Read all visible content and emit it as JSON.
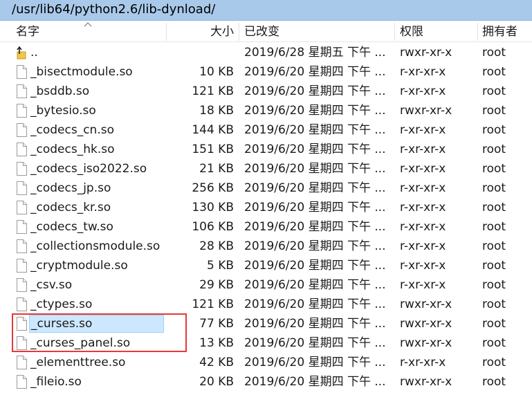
{
  "path": "/usr/lib64/python2.6/lib-dynload/",
  "columns": {
    "name": "名字",
    "size": "大小",
    "modified": "已改变",
    "permissions": "权限",
    "owner": "拥有者"
  },
  "rows": [
    {
      "name": "..",
      "size": "",
      "modified": "2019/6/28 星期五 下午 ...",
      "perm": "rwxr-xr-x",
      "owner": "root",
      "icon": "parent-folder-icon"
    },
    {
      "name": "_bisectmodule.so",
      "size": "10 KB",
      "modified": "2019/6/20 星期四 下午 ...",
      "perm": "r-xr-xr-x",
      "owner": "root",
      "icon": "file-icon"
    },
    {
      "name": "_bsddb.so",
      "size": "121 KB",
      "modified": "2019/6/20 星期四 下午 ...",
      "perm": "r-xr-xr-x",
      "owner": "root",
      "icon": "file-icon"
    },
    {
      "name": "_bytesio.so",
      "size": "18 KB",
      "modified": "2019/6/20 星期四 下午 ...",
      "perm": "rwxr-xr-x",
      "owner": "root",
      "icon": "file-icon"
    },
    {
      "name": "_codecs_cn.so",
      "size": "144 KB",
      "modified": "2019/6/20 星期四 下午 ...",
      "perm": "r-xr-xr-x",
      "owner": "root",
      "icon": "file-icon"
    },
    {
      "name": "_codecs_hk.so",
      "size": "151 KB",
      "modified": "2019/6/20 星期四 下午 ...",
      "perm": "r-xr-xr-x",
      "owner": "root",
      "icon": "file-icon"
    },
    {
      "name": "_codecs_iso2022.so",
      "size": "21 KB",
      "modified": "2019/6/20 星期四 下午 ...",
      "perm": "r-xr-xr-x",
      "owner": "root",
      "icon": "file-icon"
    },
    {
      "name": "_codecs_jp.so",
      "size": "256 KB",
      "modified": "2019/6/20 星期四 下午 ...",
      "perm": "r-xr-xr-x",
      "owner": "root",
      "icon": "file-icon"
    },
    {
      "name": "_codecs_kr.so",
      "size": "130 KB",
      "modified": "2019/6/20 星期四 下午 ...",
      "perm": "r-xr-xr-x",
      "owner": "root",
      "icon": "file-icon"
    },
    {
      "name": "_codecs_tw.so",
      "size": "106 KB",
      "modified": "2019/6/20 星期四 下午 ...",
      "perm": "r-xr-xr-x",
      "owner": "root",
      "icon": "file-icon"
    },
    {
      "name": "_collectionsmodule.so",
      "size": "28 KB",
      "modified": "2019/6/20 星期四 下午 ...",
      "perm": "r-xr-xr-x",
      "owner": "root",
      "icon": "file-icon"
    },
    {
      "name": "_cryptmodule.so",
      "size": "5 KB",
      "modified": "2019/6/20 星期四 下午 ...",
      "perm": "r-xr-xr-x",
      "owner": "root",
      "icon": "file-icon"
    },
    {
      "name": "_csv.so",
      "size": "29 KB",
      "modified": "2019/6/20 星期四 下午 ...",
      "perm": "r-xr-xr-x",
      "owner": "root",
      "icon": "file-icon"
    },
    {
      "name": "_ctypes.so",
      "size": "121 KB",
      "modified": "2019/6/20 星期四 下午 ...",
      "perm": "rwxr-xr-x",
      "owner": "root",
      "icon": "file-icon"
    },
    {
      "name": "_curses.so",
      "size": "77 KB",
      "modified": "2019/6/20 星期四 下午 ...",
      "perm": "rwxr-xr-x",
      "owner": "root",
      "icon": "file-icon",
      "selected": true
    },
    {
      "name": "_curses_panel.so",
      "size": "13 KB",
      "modified": "2019/6/20 星期四 下午 ...",
      "perm": "rwxr-xr-x",
      "owner": "root",
      "icon": "file-icon"
    },
    {
      "name": "_elementtree.so",
      "size": "42 KB",
      "modified": "2019/6/20 星期四 下午 ...",
      "perm": "r-xr-xr-x",
      "owner": "root",
      "icon": "file-icon"
    },
    {
      "name": "_fileio.so",
      "size": "20 KB",
      "modified": "2019/6/20 星期四 下午 ...",
      "perm": "rwxr-xr-x",
      "owner": "root",
      "icon": "file-icon"
    }
  ],
  "colors": {
    "pathbar_bg": "#a9c9ea",
    "selection_bg": "#cce8ff",
    "selection_border": "#99d1ff",
    "annotation_box": "#e53935"
  }
}
